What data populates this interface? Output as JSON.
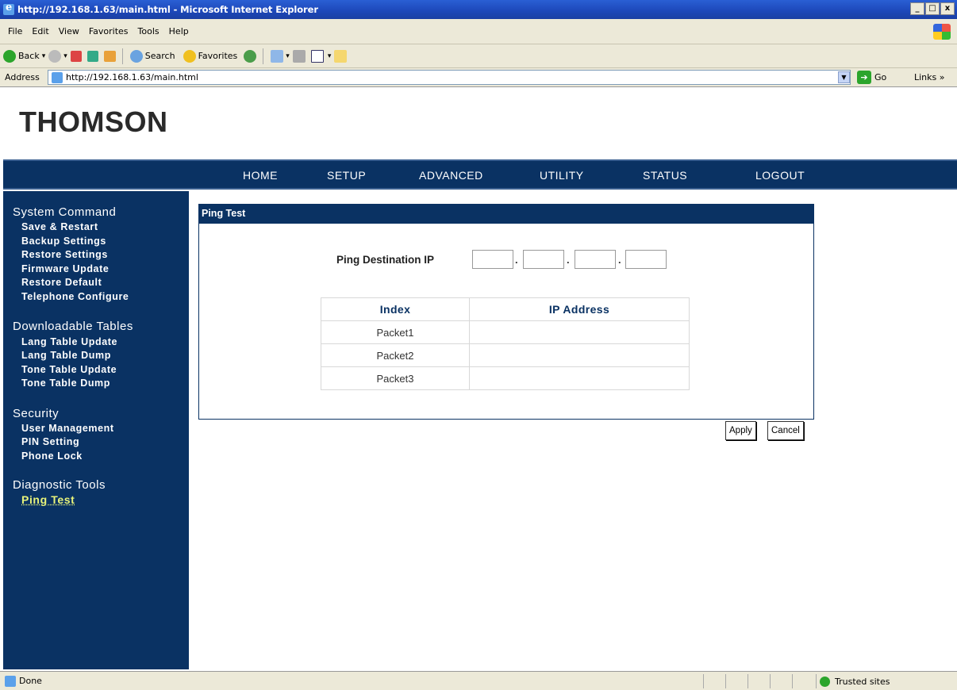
{
  "window": {
    "title": "http://192.168.1.63/main.html - Microsoft Internet Explorer",
    "min": "_",
    "max": "□",
    "close": "x"
  },
  "menu": [
    "File",
    "Edit",
    "View",
    "Favorites",
    "Tools",
    "Help"
  ],
  "toolbar": {
    "back": "Back",
    "search": "Search",
    "favorites": "Favorites"
  },
  "address": {
    "label": "Address",
    "url": "http://192.168.1.63/main.html",
    "go": "Go",
    "links": "Links »"
  },
  "brand": "THOMSON",
  "nav": [
    "HOME",
    "SETUP",
    "ADVANCED",
    "UTILITY",
    "STATUS",
    "LOGOUT"
  ],
  "sidebar": {
    "groups": [
      {
        "title": "System Command",
        "items": [
          "Save & Restart",
          "Backup Settings",
          "Restore Settings",
          "Firmware Update",
          "Restore Default",
          "Telephone Configure"
        ]
      },
      {
        "title": "Downloadable Tables",
        "items": [
          "Lang Table Update",
          "Lang Table Dump",
          "Tone Table Update",
          "Tone Table Dump"
        ]
      },
      {
        "title": "Security",
        "items": [
          "User Management",
          "PIN Setting",
          "Phone Lock"
        ]
      },
      {
        "title": "Diagnostic Tools",
        "items": [
          "Ping Test"
        ]
      }
    ],
    "active": "Ping Test"
  },
  "panel": {
    "title": "Ping Test",
    "dest_label": "Ping Destination IP",
    "ip": [
      "",
      "",
      "",
      ""
    ],
    "table": {
      "headers": [
        "Index",
        "IP Address"
      ],
      "rows": [
        [
          "Packet1",
          ""
        ],
        [
          "Packet2",
          ""
        ],
        [
          "Packet3",
          ""
        ]
      ]
    },
    "apply": "Apply",
    "cancel": "Cancel"
  },
  "status": {
    "text": "Done",
    "zone": "Trusted sites"
  }
}
